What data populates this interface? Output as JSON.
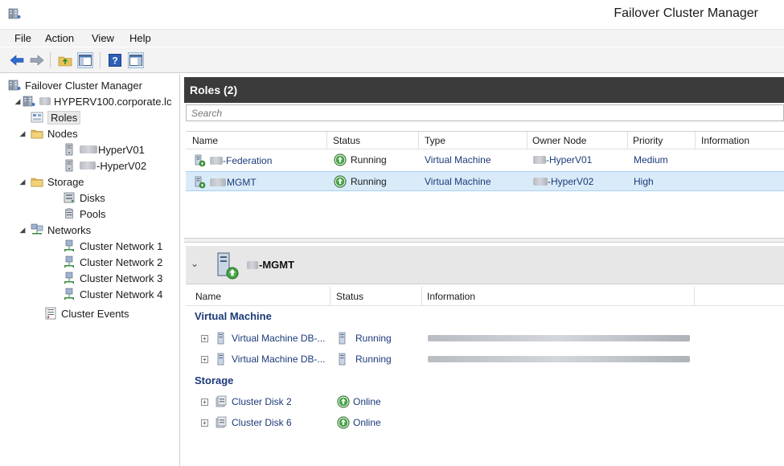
{
  "window": {
    "title": "Failover Cluster Manager",
    "icon": "cluster-icon"
  },
  "menu": [
    "File",
    "Action",
    "View",
    "Help"
  ],
  "toolbar": {
    "buttons": [
      "back-arrow-icon",
      "forward-arrow-icon",
      "up-folder-icon",
      "show-hide-tree-icon",
      "help-icon",
      "show-hide-action-pane-icon"
    ]
  },
  "tree": {
    "root": "Failover Cluster Manager",
    "cluster": "HYPERV100.corporate.lc",
    "roles": "Roles",
    "nodes": "Nodes",
    "node1": "HyperV01",
    "node2": "-HyperV02",
    "storage": "Storage",
    "disks": "Disks",
    "pools": "Pools",
    "networks": "Networks",
    "net1": "Cluster Network 1",
    "net2": "Cluster Network 2",
    "net3": "Cluster Network 3",
    "net4": "Cluster Network 4",
    "events": "Cluster Events"
  },
  "roles_panel": {
    "title": "Roles (2)",
    "search_placeholder": "Search",
    "columns": [
      "Name",
      "Status",
      "Type",
      "Owner Node",
      "Priority",
      "Information"
    ],
    "rows": [
      {
        "name": "-Federation",
        "status": "Running",
        "type": "Virtual Machine",
        "owner": "-HyperV01",
        "priority": "Medium",
        "info": ""
      },
      {
        "name": "MGMT",
        "status": "Running",
        "type": "Virtual Machine",
        "owner": "-HyperV02",
        "priority": "High",
        "info": ""
      }
    ]
  },
  "detail": {
    "name": "-MGMT",
    "columns": [
      "Name",
      "Status",
      "Information"
    ],
    "groups": {
      "vm": "Virtual Machine",
      "storage": "Storage"
    },
    "vm_rows": [
      {
        "name": "Virtual Machine DB-...",
        "status": "Running"
      },
      {
        "name": "Virtual Machine DB-...",
        "status": "Running"
      }
    ],
    "storage_rows": [
      {
        "name": "Cluster Disk 2",
        "status": "Online"
      },
      {
        "name": "Cluster Disk 6",
        "status": "Online"
      }
    ]
  },
  "colors": {
    "header_dark": "#3b3b3b",
    "selection": "#d9ebf9",
    "link_blue": "#1c3a78",
    "running_green": "#3a9a3a"
  }
}
